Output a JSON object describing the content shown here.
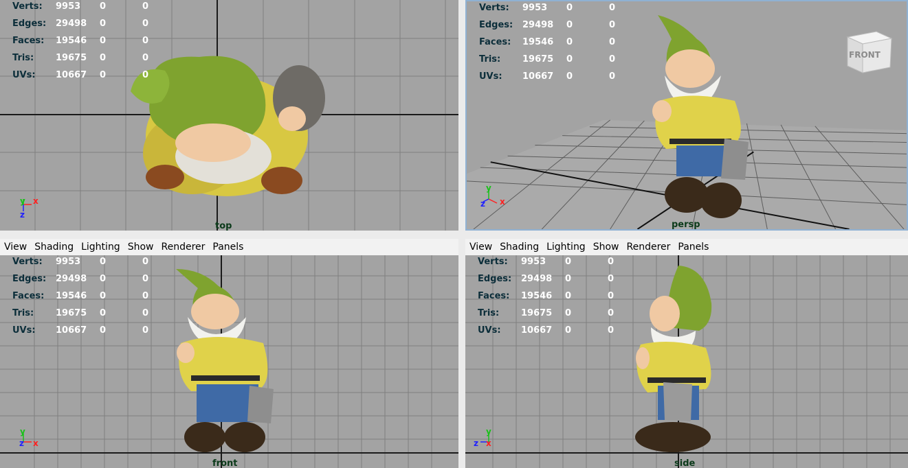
{
  "menu": [
    "View",
    "Shading",
    "Lighting",
    "Show",
    "Renderer",
    "Panels"
  ],
  "stats": [
    {
      "label": "Verts:",
      "v1": "9953",
      "v2": "0",
      "v3": "0"
    },
    {
      "label": "Edges:",
      "v1": "29498",
      "v2": "0",
      "v3": "0"
    },
    {
      "label": "Faces:",
      "v1": "19546",
      "v2": "0",
      "v3": "0"
    },
    {
      "label": "Tris:",
      "v1": "19675",
      "v2": "0",
      "v3": "0"
    },
    {
      "label": "UVs:",
      "v1": "10667",
      "v2": "0",
      "v3": "0"
    }
  ],
  "viewports": [
    {
      "camera": "top",
      "axis_a": "y",
      "axis_b": "x",
      "axis_c": "z"
    },
    {
      "camera": "persp",
      "axis_a": "y",
      "axis_b": "x",
      "axis_c": "z"
    },
    {
      "camera": "front",
      "axis_a": "y",
      "axis_b": "x",
      "axis_c": "z"
    },
    {
      "camera": "side",
      "axis_a": "y",
      "axis_b": "x",
      "axis_c": "z"
    }
  ],
  "viewcube_label": "FRONT",
  "colors": {
    "viewport_bg": "#a3a3a3",
    "grid": "#7f7f7f",
    "axis_line": "#1a1a1a",
    "selected_border": "#8fb1d3",
    "hud_label": "#0c2e3a",
    "hud_value": "#ffffff",
    "camera_label": "#0b3a1a",
    "hat": "#7fa32f",
    "shirt": "#e0d24a",
    "pants": "#3f6aa6",
    "boots": "#3a2a1a"
  }
}
